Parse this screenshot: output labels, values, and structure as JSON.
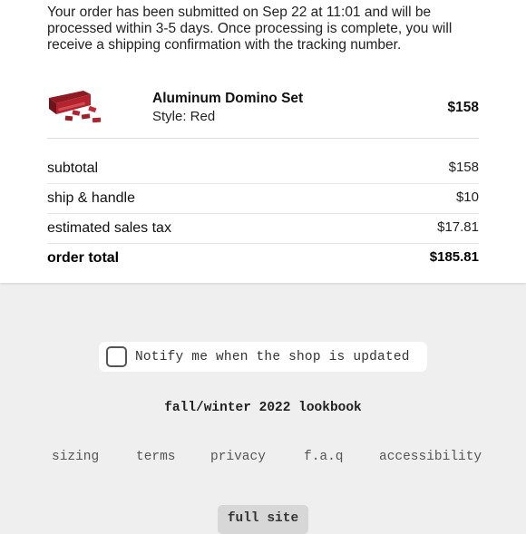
{
  "order": {
    "message": "Your order has been submitted on Sep 22 at 11:01 and will be processed within 3-5 days. Once processing is complete, you will receive a shipping confirmation with the tracking number."
  },
  "item": {
    "name": "Aluminum Domino Set",
    "style": "Style: Red",
    "price": "$158",
    "image_icon": "domino-set-thumbnail",
    "image_color": "#b3232e"
  },
  "totals": {
    "subtotal_label": "subtotal",
    "subtotal_value": "$158",
    "shipping_label": "ship & handle",
    "shipping_value": "$10",
    "tax_label": "estimated sales tax",
    "tax_value": "$17.81",
    "total_label": "order total",
    "total_value": "$185.81"
  },
  "notify": {
    "label": "Notify me when the shop is updated",
    "checked": false
  },
  "lookbook": {
    "label": "fall/winter 2022 lookbook"
  },
  "footer": {
    "links": [
      "sizing",
      "terms",
      "privacy",
      "f.a.q",
      "accessibility"
    ],
    "full_site": "full site"
  },
  "colors": {
    "card_background": "#ffffff",
    "page_background": "#efefef",
    "button_background": "#d7d7d7"
  }
}
